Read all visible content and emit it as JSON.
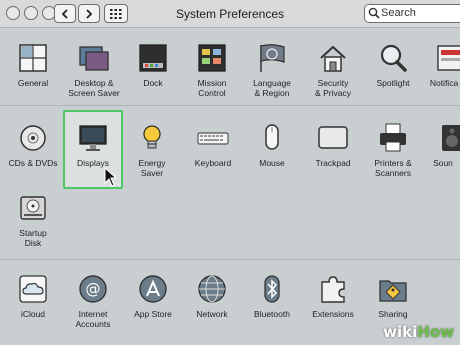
{
  "window": {
    "title": "System Preferences"
  },
  "search": {
    "text": "Search"
  },
  "row1": [
    {
      "label": "General",
      "icon": "general-icon"
    },
    {
      "label": "Desktop &\nScreen Saver",
      "icon": "desktop-icon"
    },
    {
      "label": "Dock",
      "icon": "dock-icon"
    },
    {
      "label": "Mission\nControl",
      "icon": "mission-control-icon"
    },
    {
      "label": "Language\n& Region",
      "icon": "language-flag-icon"
    },
    {
      "label": "Security\n& Privacy",
      "icon": "house-lock-icon"
    },
    {
      "label": "Spotlight",
      "icon": "magnifier-icon"
    },
    {
      "label": "Notifica",
      "icon": "notifications-icon"
    }
  ],
  "row2": [
    {
      "label": "CDs & DVDs",
      "icon": "disc-icon"
    },
    {
      "label": "Displays",
      "icon": "monitor-icon"
    },
    {
      "label": "Energy\nSaver",
      "icon": "lightbulb-icon"
    },
    {
      "label": "Keyboard",
      "icon": "keyboard-icon"
    },
    {
      "label": "Mouse",
      "icon": "mouse-icon"
    },
    {
      "label": "Trackpad",
      "icon": "trackpad-icon"
    },
    {
      "label": "Printers &\nScanners",
      "icon": "printer-icon"
    },
    {
      "label": "Soun",
      "icon": "speaker-icon"
    }
  ],
  "row3": [
    {
      "label": "Startup\nDisk",
      "icon": "disk-icon"
    }
  ],
  "row4": [
    {
      "label": "iCloud",
      "icon": "cloud-icon"
    },
    {
      "label": "Internet\nAccounts",
      "icon": "at-sign-icon"
    },
    {
      "label": "App Store",
      "icon": "app-store-icon"
    },
    {
      "label": "Network",
      "icon": "globe-icon"
    },
    {
      "label": "Bluetooth",
      "icon": "bluetooth-icon"
    },
    {
      "label": "Extensions",
      "icon": "puzzle-icon"
    },
    {
      "label": "Sharing",
      "icon": "sharing-folder-icon"
    }
  ],
  "watermark": {
    "wiki": "wiki",
    "how": "How"
  }
}
